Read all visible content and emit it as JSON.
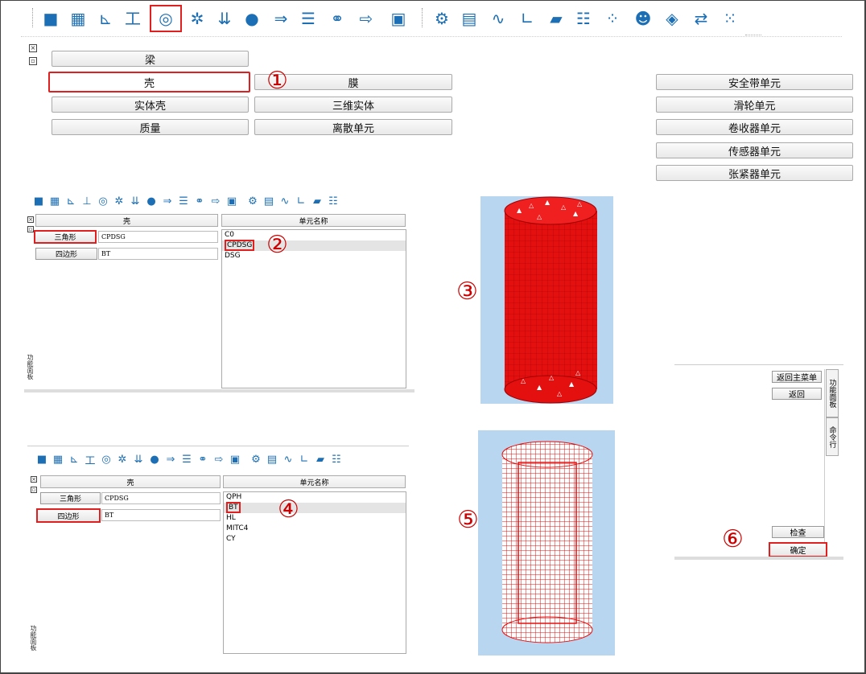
{
  "main_toolbar": {
    "icons": [
      "cube-icon",
      "mesh-cube-icon",
      "xy-plot-icon",
      "beam-section-icon",
      "shell-element-icon",
      "gear-pair-icon",
      "load-arrows-icon",
      "airbag-icon",
      "pipe-icon",
      "weld-icon",
      "contact-spheres-icon",
      "part-export-icon",
      "calculator-icon",
      "settings-gear-icon",
      "grid-table-icon",
      "curve-icon",
      "axis-plot-icon",
      "plane-icon",
      "table-list-icon",
      "dotted-sphere-icon",
      "dummy-icon",
      "wireframe-cube-icon",
      "exchange-arrows-icon",
      "dots-cube-icon"
    ]
  },
  "element_menu": {
    "left_col1": [
      "梁",
      "壳",
      "实体壳",
      "质量"
    ],
    "left_col2": [
      "膜",
      "三维实体",
      "离散单元"
    ],
    "right_col": [
      "安全带单元",
      "滑轮单元",
      "卷收器单元",
      "传感器单元",
      "张紧器单元"
    ]
  },
  "steps": [
    "①",
    "②",
    "③",
    "④",
    "⑤",
    "⑥"
  ],
  "shell_panel_tri": {
    "header_left": "壳",
    "header_right": "单元名称",
    "rows": [
      {
        "label": "三角形",
        "value": "CPDSG"
      },
      {
        "label": "四边形",
        "value": "BT"
      }
    ],
    "list": [
      "C0",
      "CPDSG",
      "DSG"
    ],
    "side_label": "功能面板"
  },
  "shell_panel_quad": {
    "header_left": "壳",
    "header_right": "单元名称",
    "rows": [
      {
        "label": "三角形",
        "value": "CPDSG"
      },
      {
        "label": "四边形",
        "value": "BT"
      }
    ],
    "list": [
      "QPH",
      "BT",
      "HL",
      "MITC4",
      "CY"
    ],
    "side_label": "功能面板"
  },
  "right_panel": {
    "btn_main_menu": "返回主菜单",
    "btn_back": "返回",
    "tab_func": "功能面板",
    "tab_cmd": "命令行",
    "btn_check": "检查",
    "btn_ok": "确定"
  },
  "colors": {
    "highlight": "#e02020",
    "mesh_red": "#e41010",
    "view_bg": "#b9d6f0"
  }
}
